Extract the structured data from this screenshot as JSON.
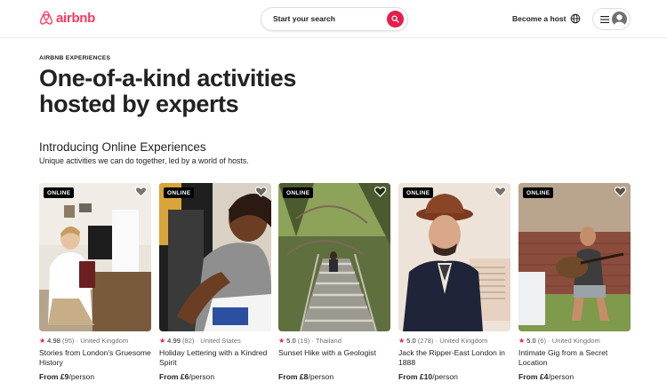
{
  "header": {
    "brand": "airbnb",
    "search_placeholder": "Start your search",
    "become_host": "Become a host"
  },
  "hero": {
    "eyebrow": "AIRBNB EXPERIENCES",
    "headline": "One-of-a-kind activities hosted by experts"
  },
  "section": {
    "title": "Introducing Online Experiences",
    "subtitle": "Unique activities we can do together, led by a world of hosts."
  },
  "cards": [
    {
      "badge": "ONLINE",
      "score": "4.98",
      "reviews": "(95)",
      "location": "· United Kingdom",
      "title": "Stories from London's Gruesome History",
      "price_bold": "From £9",
      "price_unit": "/person"
    },
    {
      "badge": "ONLINE",
      "score": "4.99",
      "reviews": "(82)",
      "location": "· United States",
      "title": "Holiday Lettering with a Kindred Spirit",
      "price_bold": "From £6",
      "price_unit": "/person"
    },
    {
      "badge": "ONLINE",
      "score": "5.0",
      "reviews": "(19)",
      "location": "· Thailand",
      "title": "Sunset Hike with a Geologist",
      "price_bold": "From £8",
      "price_unit": "/person"
    },
    {
      "badge": "ONLINE",
      "score": "5.0",
      "reviews": "(278)",
      "location": "· United Kingdom",
      "title": "Jack the Ripper-East London in 1888",
      "price_bold": "From £10",
      "price_unit": "/person"
    },
    {
      "badge": "ONLINE",
      "score": "5.0",
      "reviews": "(6)",
      "location": "· United Kingdom",
      "title": "Intimate Gig from a Secret Location",
      "price_bold": "From £4",
      "price_unit": "/person"
    }
  ],
  "colors": {
    "brand": "#FF385C",
    "search_button": "#E61E4D",
    "text": "#222222",
    "muted": "#717171"
  },
  "icons": [
    "airbnb-logo-icon",
    "search-icon",
    "globe-icon",
    "menu-icon",
    "user-avatar-icon",
    "heart-icon",
    "star-icon"
  ]
}
